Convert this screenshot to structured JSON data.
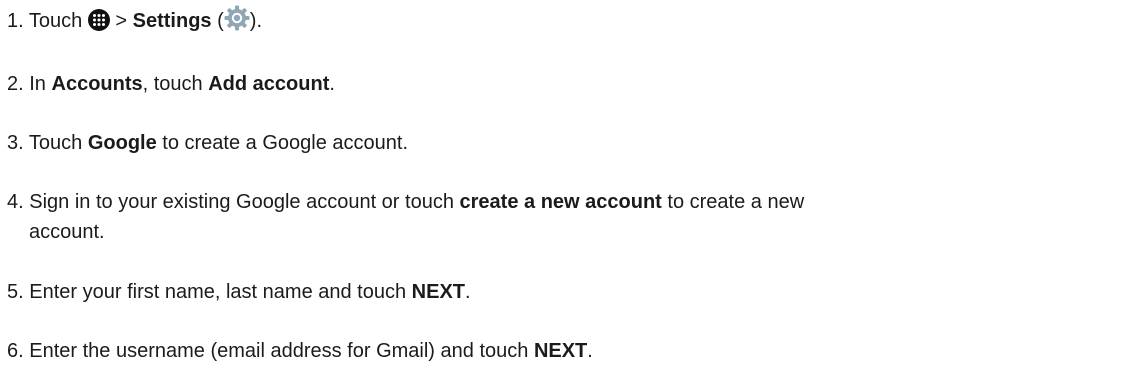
{
  "steps": [
    {
      "num": "1.",
      "parts": {
        "a": "Touch",
        "b": ">",
        "c": "Settings",
        "d": "(",
        "e": ")."
      },
      "icons": [
        "app-drawer-icon",
        "settings-gear-icon"
      ]
    },
    {
      "num": "2.",
      "parts": {
        "a": "In",
        "b": "Accounts",
        "c": ", touch",
        "d": "Add account",
        "e": "."
      }
    },
    {
      "num": "3.",
      "parts": {
        "a": "Touch",
        "b": "Google",
        "c": "to create a Google account."
      }
    },
    {
      "num": "4.",
      "parts": {
        "a": "Sign in to your existing Google account or touch",
        "b": "create a new account",
        "c": "to create a new",
        "d": "account."
      }
    },
    {
      "num": "5.",
      "parts": {
        "a": "Enter your first name, last name and touch",
        "b": "NEXT",
        "c": "."
      }
    },
    {
      "num": "6.",
      "parts": {
        "a": "Enter the username (email address for Gmail) and touch",
        "b": "NEXT",
        "c": "."
      }
    }
  ],
  "colors": {
    "text": "#1b1b1b",
    "gear": "#8fa7b5"
  }
}
